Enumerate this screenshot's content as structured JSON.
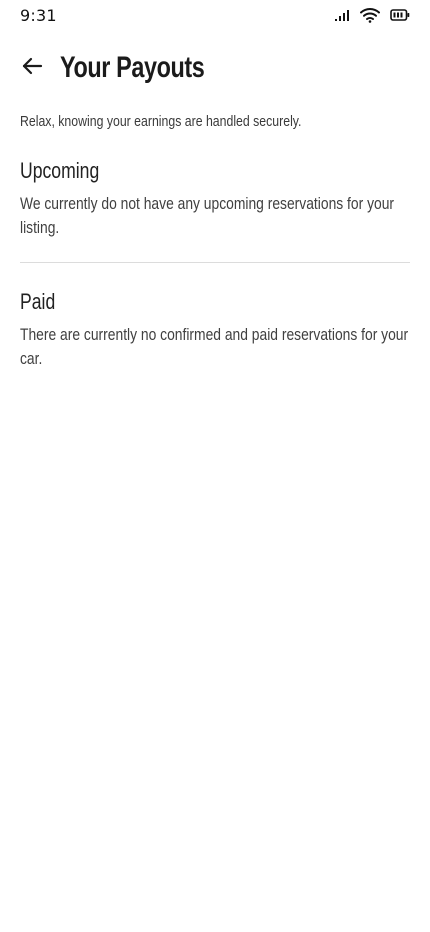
{
  "status_bar": {
    "time": "9:31"
  },
  "header": {
    "title": "Your Payouts",
    "back_icon": "arrow-left-icon"
  },
  "content": {
    "subtitle": "Relax, knowing your earnings are handled securely.",
    "sections": [
      {
        "title": "Upcoming",
        "text": "We currently do not have any upcoming reservations for your listing."
      },
      {
        "title": "Paid",
        "text": "There are currently no confirmed and paid reservations for your car."
      }
    ]
  },
  "colors": {
    "background": "#ffffff",
    "text_primary": "#1b1b1b",
    "text_secondary": "#404040",
    "divider": "#dcdcdc"
  }
}
